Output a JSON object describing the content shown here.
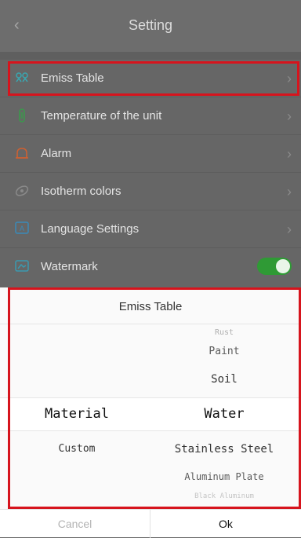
{
  "header": {
    "title": "Setting",
    "back_icon": "chevron-left-icon"
  },
  "settings": [
    {
      "label": "Emiss Table",
      "icon": "emiss-table-icon",
      "trailing": "chevron"
    },
    {
      "label": "Temperature of the unit",
      "icon": "thermometer-icon",
      "trailing": "chevron"
    },
    {
      "label": "Alarm",
      "icon": "alarm-icon",
      "trailing": "chevron"
    },
    {
      "label": "Isotherm colors",
      "icon": "isotherm-icon",
      "trailing": "chevron"
    },
    {
      "label": "Language Settings",
      "icon": "language-icon",
      "trailing": "chevron"
    },
    {
      "label": "Watermark",
      "icon": "watermark-icon",
      "trailing": "toggle",
      "toggle_on": true
    }
  ],
  "dialog": {
    "title": "Emiss Table",
    "left_column": {
      "selected": "Material",
      "below": "Custom"
    },
    "right_column": {
      "items": [
        "Rust",
        "Paint",
        "Soil",
        "Water",
        "Stainless Steel",
        "Aluminum Plate",
        "Black Aluminum"
      ],
      "selected": "Water"
    },
    "cancel": "Cancel",
    "ok": "Ok"
  },
  "colors": {
    "highlight": "#d6141d",
    "toggle_on": "#2f9a35"
  }
}
